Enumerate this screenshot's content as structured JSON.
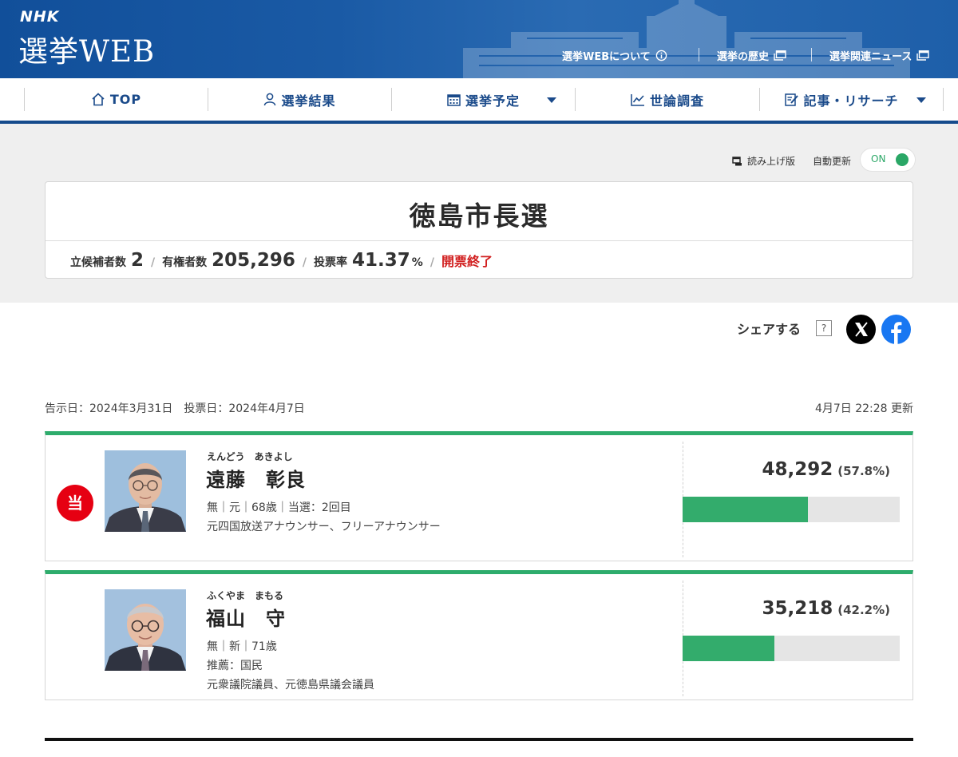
{
  "header": {
    "brand": "NHK",
    "site_title": "選挙WEB",
    "links": [
      {
        "label": "選挙WEBについて",
        "icon": "info-icon"
      },
      {
        "label": "選挙の歴史",
        "icon": "external-window-icon"
      },
      {
        "label": "選挙関連ニュース",
        "icon": "external-window-icon"
      }
    ]
  },
  "nav": {
    "items": [
      {
        "label": "TOP",
        "icon": "home-icon"
      },
      {
        "label": "選挙結果",
        "icon": "person-icon"
      },
      {
        "label": "選挙予定",
        "icon": "calendar-icon",
        "dropdown": true
      },
      {
        "label": "世論調査",
        "icon": "line-chart-icon"
      },
      {
        "label": "記事・リサーチ",
        "icon": "article-edit-icon",
        "dropdown": true
      }
    ]
  },
  "toolbar": {
    "readout_label": "読み上げ版",
    "auto_update_label": "自動更新",
    "auto_update_state": "ON"
  },
  "election": {
    "title": "徳島市長選",
    "candidates_label": "立候補者数",
    "candidates_value": "2",
    "voters_label": "有権者数",
    "voters_value": "205,296",
    "turnout_label": "投票率",
    "turnout_value": "41.37",
    "turnout_unit": "%",
    "status": "開票終了"
  },
  "share": {
    "label": "シェアする",
    "help": "?"
  },
  "dates": {
    "announced": "告示日：2024年3月31日　投票日：2024年4月7日",
    "updated": "4月7日 22:28 更新"
  },
  "candidates": [
    {
      "kana": "えんどう　あきよし",
      "name": "遠藤　彰良",
      "elected_badge": "当",
      "elected": true,
      "line1": "無｜元｜68歳｜当選：2回目",
      "line2": "元四国放送アナウンサー、フリーアナウンサー",
      "votes": "48,292",
      "percent": "(57.8%)",
      "share": 0.578
    },
    {
      "kana": "ふくやま　まもる",
      "name": "福山　守",
      "elected": false,
      "line1": "無｜新｜71歳",
      "line2": "推薦：国民",
      "line3": "元衆議院議員、元徳島県議会議員",
      "votes": "35,218",
      "percent": "(42.2%)",
      "share": 0.422
    }
  ],
  "colors": {
    "header_blue": "#1a5aa5",
    "nav_text": "#1a4a8a",
    "result_green": "#33ac6c",
    "elected_red": "#e60012",
    "status_red": "#d11f1f"
  }
}
